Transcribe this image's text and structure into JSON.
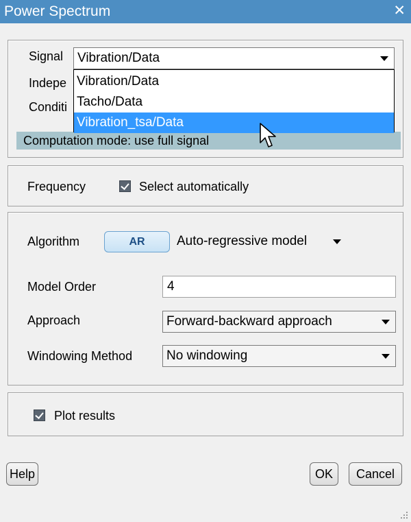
{
  "window": {
    "title": "Power Spectrum",
    "close_glyph": "✕"
  },
  "signal_panel": {
    "signal_label": "Signal",
    "signal_value": "Vibration/Data",
    "independent_label": "Indepe",
    "condition_label": "Conditi",
    "options": [
      "Vibration/Data",
      "Tacho/Data",
      "Vibration_tsa/Data"
    ],
    "selected_option_index": 2,
    "status_text": "Computation mode: use full signal"
  },
  "frequency_panel": {
    "label": "Frequency",
    "checkbox_label": "Select automatically",
    "checked": true
  },
  "algorithm_panel": {
    "algorithm_label": "Algorithm",
    "algorithm_button": "AR",
    "algorithm_mode": "Auto-regressive model",
    "model_order_label": "Model Order",
    "model_order_value": "4",
    "approach_label": "Approach",
    "approach_value": "Forward-backward approach",
    "windowing_label": "Windowing Method",
    "windowing_value": "No windowing"
  },
  "plot_panel": {
    "checkbox_label": "Plot results",
    "checked": true
  },
  "buttons": {
    "help": "Help",
    "ok": "OK",
    "cancel": "Cancel"
  },
  "colors": {
    "titlebar": "#4d8ec3",
    "selection": "#3399ff",
    "status_bg": "#a7c4cc"
  }
}
